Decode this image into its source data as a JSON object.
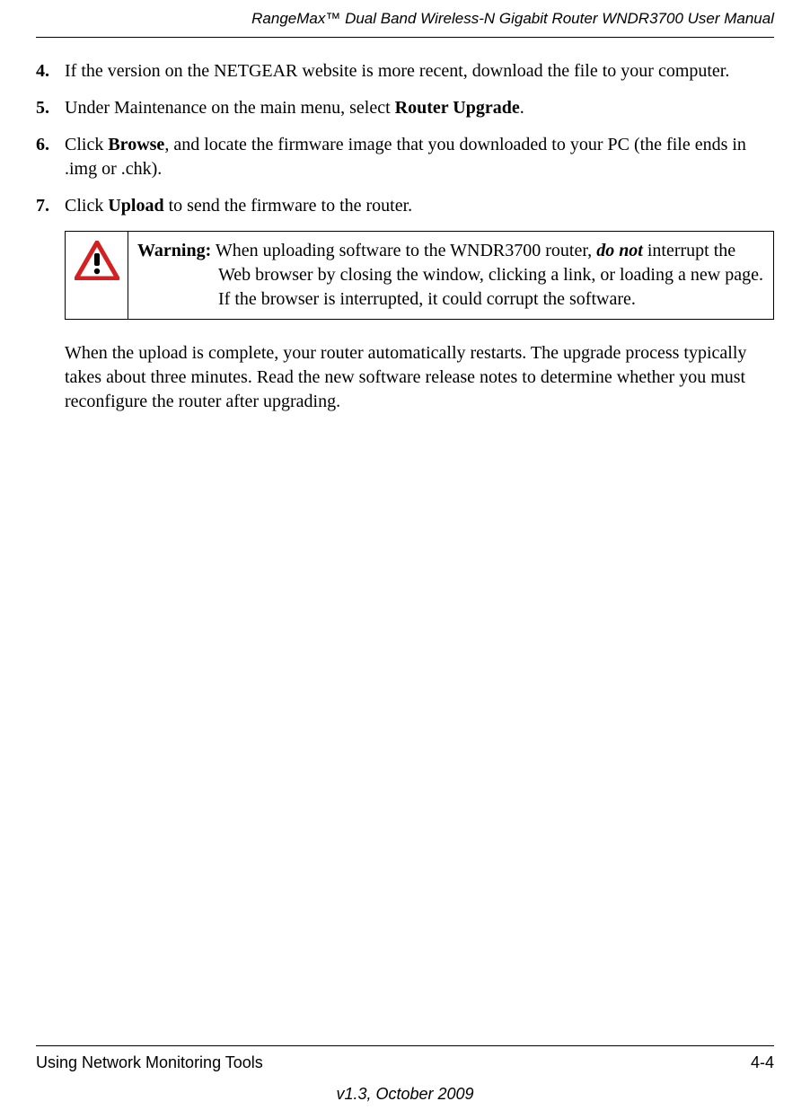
{
  "header": {
    "title": "RangeMax™ Dual Band Wireless-N Gigabit Router WNDR3700 User Manual"
  },
  "steps": {
    "s4": {
      "num": "4.",
      "text_before": "If the version on the NETGEAR website is more recent, download the file to your computer."
    },
    "s5": {
      "num": "5.",
      "pre": "Under Maintenance on the main menu, select ",
      "bold": "Router Upgrade",
      "post": "."
    },
    "s6": {
      "num": "6.",
      "pre": "Click ",
      "bold": "Browse",
      "post": ", and locate the firmware image that you downloaded to your PC (the file ends in .img or .chk)."
    },
    "s7": {
      "num": "7.",
      "pre": "Click ",
      "bold": "Upload",
      "post": " to send the firmware to the router."
    }
  },
  "warning": {
    "label": "Warning:",
    "pre": " When uploading software to the WNDR3700 router, ",
    "emph": "do not",
    "post": " interrupt the Web browser by closing the window, clicking a link, or loading a new page. If the browser is interrupted, it could corrupt the software."
  },
  "after_warning": "When the upload is complete, your router automatically restarts. The upgrade process typically takes about three minutes. Read the new software release notes to determine whether you must reconfigure the router after upgrading.",
  "footer": {
    "section": "Using Network Monitoring Tools",
    "page": "4-4",
    "version": "v1.3, October 2009"
  }
}
